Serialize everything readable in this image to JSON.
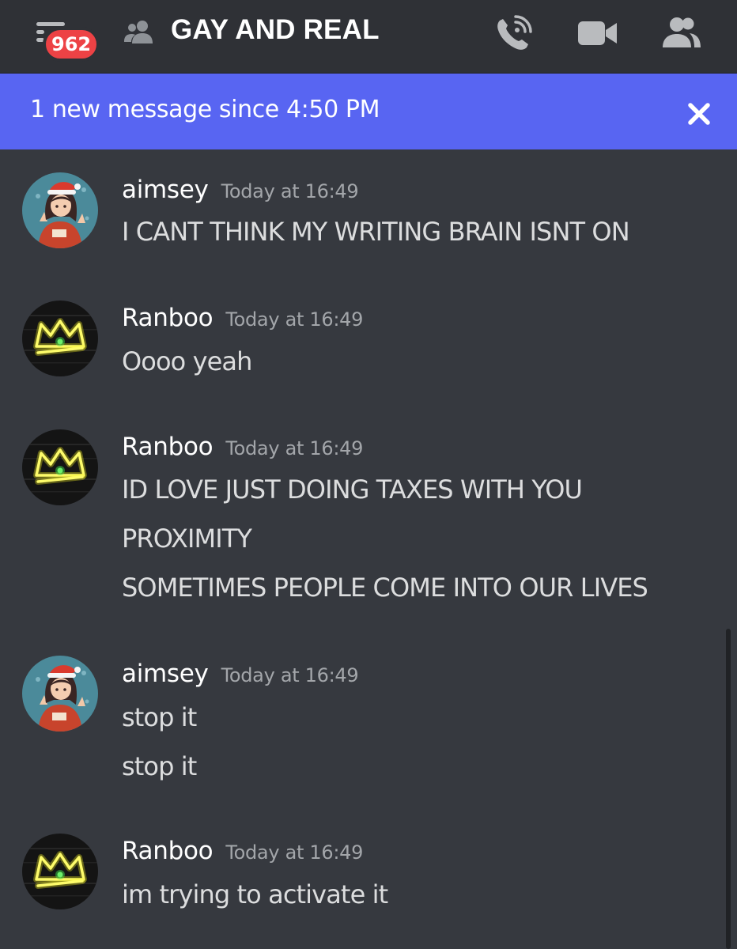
{
  "header": {
    "badge_count": "962",
    "channel_title": "GAY AND REAL",
    "icons": [
      "hamburger-menu-icon",
      "group-dm-icon",
      "voice-call-icon",
      "video-call-icon",
      "member-list-icon"
    ]
  },
  "banner": {
    "text": "1 new message since 4:50 PM",
    "color": "#5865f2"
  },
  "messages": [
    {
      "author": "aimsey",
      "timestamp": "Today at 16:49",
      "avatar": "aimsey-avatar",
      "lines": [
        "I CANT THINK MY WRITING BRAIN ISNT ON"
      ]
    },
    {
      "author": "Ranboo",
      "timestamp": "Today at 16:49",
      "avatar": "ranboo-crown-avatar",
      "lines": [
        "Oooo yeah"
      ]
    },
    {
      "author": "Ranboo",
      "timestamp": "Today at 16:49",
      "avatar": "ranboo-crown-avatar",
      "lines": [
        "ID LOVE JUST DOING TAXES WITH YOU",
        "PROXIMITY",
        "SOMETIMES PEOPLE COME INTO OUR LIVES"
      ]
    },
    {
      "author": "aimsey",
      "timestamp": "Today at 16:49",
      "avatar": "aimsey-avatar",
      "lines": [
        "stop it",
        "stop it"
      ]
    },
    {
      "author": "Ranboo",
      "timestamp": "Today at 16:49",
      "avatar": "ranboo-crown-avatar",
      "lines": [
        "im trying to activate it"
      ]
    }
  ],
  "colors": {
    "background": "#36393f",
    "header": "#2f3136",
    "badge": "#ed4245",
    "accent": "#5865f2"
  }
}
